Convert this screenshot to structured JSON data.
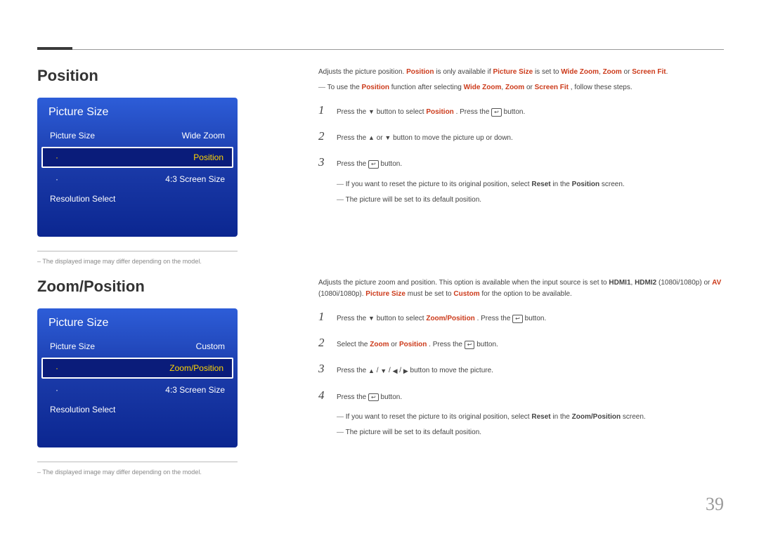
{
  "pageNumber": "39",
  "section1": {
    "title": "Position",
    "menu": {
      "header": "Picture Size",
      "row1": {
        "label": "Picture Size",
        "value": "Wide Zoom"
      },
      "row2": {
        "label": "Position"
      },
      "row3": {
        "label": "4:3 Screen Size"
      },
      "row4": {
        "label": "Resolution Select"
      }
    },
    "disclaimer": "The displayed image may differ depending on the model.",
    "intro_a": "Adjusts the picture position.",
    "intro_b": " is only available if ",
    "intro_c": " is set to ",
    "intro_wz": "Wide Zoom",
    "intro_zoom": "Zoom",
    "intro_sf": "Screen Fit",
    "intro_pos": "Position",
    "intro_ps": "Picture Size",
    "subline_a": "To use the ",
    "subline_b": " function after selecting ",
    "subline_c": ", follow these steps.",
    "step1_a": "Press the ",
    "step1_b": " button to select ",
    "step1_c": ". Press the ",
    "step1_d": " button.",
    "step2_a": "Press the ",
    "step2_b": " or ",
    "step2_c": " button to move the picture up or down.",
    "step3_a": "Press the ",
    "step3_b": " button.",
    "note1_a": "If you want to reset the picture to its original position, select ",
    "note1_b": " in the ",
    "note1_c": " screen.",
    "reset": "Reset",
    "note2": "The picture will be set to its default position."
  },
  "section2": {
    "title": "Zoom/Position",
    "menu": {
      "header": "Picture Size",
      "row1": {
        "label": "Picture Size",
        "value": "Custom"
      },
      "row2": {
        "label": "Zoom/Position"
      },
      "row3": {
        "label": "4:3 Screen Size"
      },
      "row4": {
        "label": "Resolution Select"
      }
    },
    "disclaimer": "The displayed image may differ depending on the model.",
    "intro_a": "Adjusts the picture zoom and position. This option is available when the input source is set to ",
    "intro_h1": "HDMI1",
    "intro_h2": "HDMI2",
    "intro_b": " (1080i/1080p) or ",
    "intro_av": "AV",
    "intro_c": " (1080i/1080p). ",
    "intro_ps": "Picture Size",
    "intro_d": " must be set to ",
    "intro_custom": "Custom",
    "intro_e": " for the option to be available.",
    "zp": "Zoom/Position",
    "step1_a": "Press the ",
    "step1_b": " button to select ",
    "step1_c": ". Press the ",
    "step1_d": " button.",
    "step2_a": "Select the ",
    "step2_zoom": "Zoom",
    "step2_or": " or ",
    "step2_pos": "Position",
    "step2_b": ". Press the ",
    "step2_c": " button.",
    "step3_a": "Press the ",
    "step3_b": " button to move the picture.",
    "step4_a": "Press the ",
    "step4_b": " button.",
    "note1_a": "If you want to reset the picture to its original position, select ",
    "note1_b": " in the ",
    "note1_c": " screen.",
    "reset": "Reset",
    "note2": "The picture will be set to its default position."
  }
}
